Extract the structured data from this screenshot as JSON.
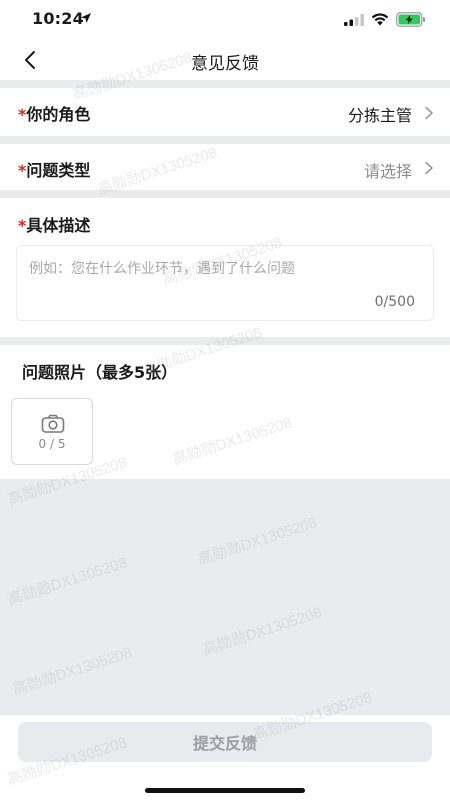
{
  "status_bar": {
    "time": "10:24"
  },
  "nav": {
    "title": "意见反馈"
  },
  "form": {
    "role": {
      "required_mark": "*",
      "label": "你的角色",
      "value": "分拣主管"
    },
    "problem_type": {
      "required_mark": "*",
      "label": "问题类型",
      "placeholder": "请选择"
    },
    "description": {
      "required_mark": "*",
      "label": "具体描述",
      "placeholder": "例如：您在什么作业环节，遇到了什么问题",
      "counter": "0/500"
    },
    "photos": {
      "label": "问题照片（最多5张）",
      "upload_count": "0 / 5"
    }
  },
  "footer": {
    "submit_label": "提交反馈"
  },
  "watermark": {
    "text": "高勋勋DX1305208"
  },
  "colors": {
    "required": "#e1251b",
    "page_background": "#e9ebee",
    "submit_disabled_bg": "#e8eaed",
    "submit_disabled_text": "#9c9ea3"
  },
  "icons": [
    "location-arrow-icon",
    "signal-icon",
    "wifi-icon",
    "battery-charging-icon",
    "back-arrow-icon",
    "chevron-right-icon",
    "camera-icon"
  ]
}
